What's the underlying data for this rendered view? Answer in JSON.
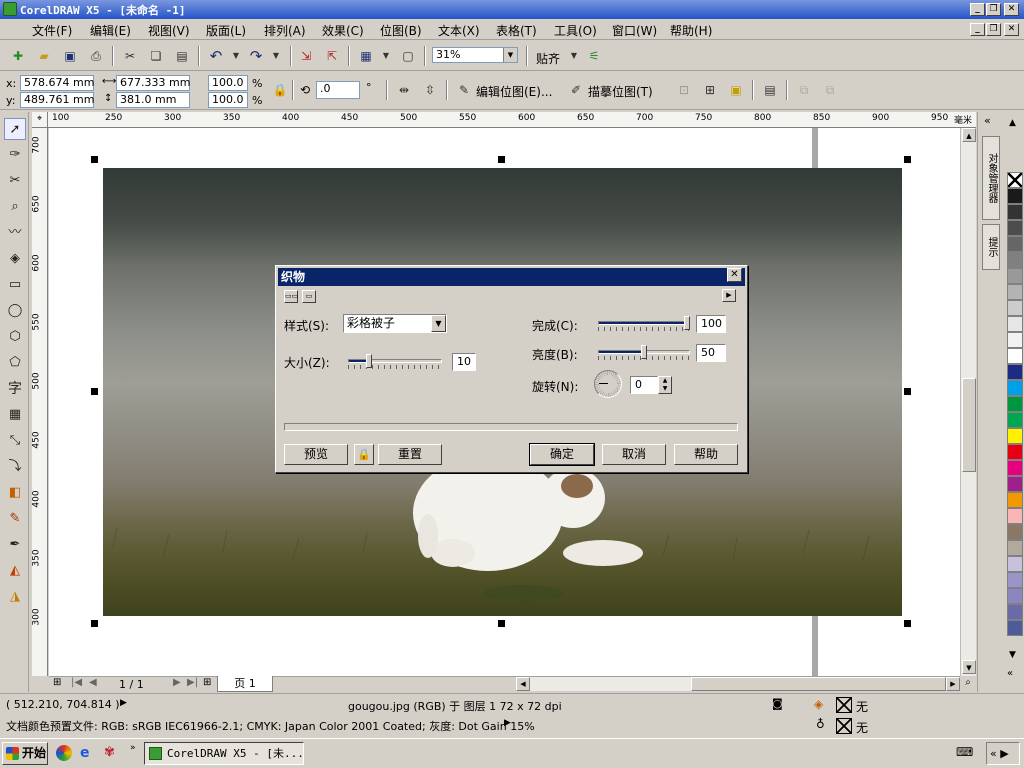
{
  "window": {
    "title": "CorelDRAW X5 - [未命名 -1]"
  },
  "menu": [
    "文件(F)",
    "编辑(E)",
    "视图(V)",
    "版面(L)",
    "排列(A)",
    "效果(C)",
    "位图(B)",
    "文本(X)",
    "表格(T)",
    "工具(O)",
    "窗口(W)",
    "帮助(H)"
  ],
  "toolbar": {
    "zoom": "31%",
    "snap_label": "贴齐",
    "x_label": "x:",
    "x_value": "578.674 mm",
    "y_label": "y:",
    "y_value": "489.761 mm",
    "width_value": "677.333 mm",
    "height_value": "381.0 mm",
    "scale_x": "100.0",
    "scale_y": "100.0",
    "percent": "%",
    "angle": ".0",
    "degree": "°",
    "edit_bitmap": "编辑位图(E)...",
    "trace_bitmap": "描摹位图(T)"
  },
  "ruler": {
    "top": [
      "100",
      "250",
      "300",
      "350",
      "400",
      "450",
      "500",
      "550",
      "600",
      "650",
      "700",
      "750",
      "800",
      "850",
      "900",
      "950"
    ],
    "unit": "毫米",
    "left": [
      "700",
      "650",
      "600",
      "550",
      "500",
      "450",
      "400",
      "350",
      "300"
    ]
  },
  "pagenav": {
    "counter": "1 / 1",
    "tab": "页 1"
  },
  "dockers": {
    "object_manager": "对象管理器",
    "hints": "提示"
  },
  "palette": [
    "#ffffff",
    "#1a1a1a",
    "#333333",
    "#4d4d4d",
    "#666666",
    "#808080",
    "#999999",
    "#b3b3b3",
    "#cccccc",
    "#e6e6e6",
    "#f2f2f2",
    "#ffffff",
    "#1e2b84",
    "#00a0e8",
    "#00963f",
    "#00a651",
    "#fff100",
    "#e60012",
    "#e4007f",
    "#a0208a",
    "#f39800",
    "#f8b6b7",
    "#8b7766",
    "#b2a89b",
    "#c7c1de",
    "#9a95c9",
    "#8b86bf",
    "#6b6aa9",
    "#4f5a9a"
  ],
  "status": {
    "coords": "( 512.210, 704.814 )",
    "object_info": "gougou.jpg (RGB) 于 图层 1 72 x 72 dpi",
    "fill_none": "无",
    "outline_none": "无",
    "color_profile": "文档颜色预置文件: RGB: sRGB IEC61966-2.1; CMYK: Japan Color 2001 Coated; 灰度: Dot Gain 15%"
  },
  "taskbar": {
    "start": "开始",
    "app": "CorelDRAW X5 - [未..."
  },
  "dialog": {
    "title": "织物",
    "style_label": "样式(S):",
    "style_value": "彩格被子",
    "size_label": "大小(Z):",
    "size_value": "10",
    "size_fraction": 0.2,
    "complete_label": "完成(C):",
    "complete_value": "100",
    "complete_fraction": 1.0,
    "brightness_label": "亮度(B):",
    "brightness_value": "50",
    "brightness_fraction": 0.5,
    "rotation_label": "旋转(N):",
    "rotation_value": "0",
    "btn_preview": "预览",
    "btn_reset": "重置",
    "btn_ok": "确定",
    "btn_cancel": "取消",
    "btn_help": "帮助"
  }
}
